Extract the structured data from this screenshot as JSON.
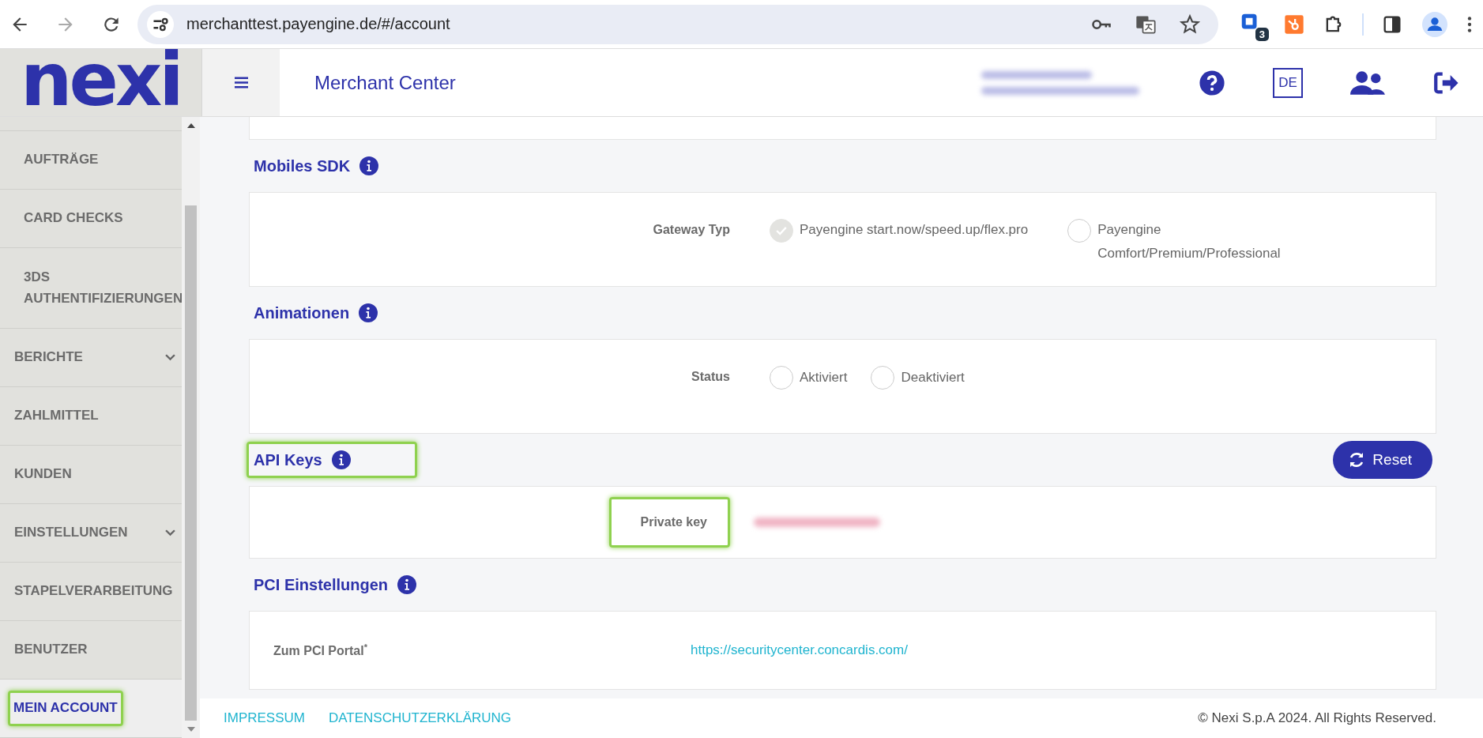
{
  "browser": {
    "url": "merchanttest.payengine.de/#/account",
    "extension_badge": "3"
  },
  "header": {
    "logo": "nexi",
    "title": "Merchant Center",
    "language": "DE"
  },
  "sidebar": {
    "items": [
      {
        "label": "AUFTRÄGE",
        "kind": "subitem",
        "expandable": false,
        "selected": false,
        "highlighted": false
      },
      {
        "label": "CARD CHECKS",
        "kind": "subitem",
        "expandable": false,
        "selected": false,
        "highlighted": false
      },
      {
        "label": "3DS AUTHENTIFIZIERUNGEN",
        "kind": "subitem",
        "expandable": false,
        "selected": false,
        "highlighted": false
      },
      {
        "label": "BERICHTE",
        "kind": "item",
        "expandable": true,
        "selected": false,
        "highlighted": false
      },
      {
        "label": "ZAHLMITTEL",
        "kind": "item",
        "expandable": false,
        "selected": false,
        "highlighted": false
      },
      {
        "label": "KUNDEN",
        "kind": "item",
        "expandable": false,
        "selected": false,
        "highlighted": false
      },
      {
        "label": "EINSTELLUNGEN",
        "kind": "item",
        "expandable": true,
        "selected": false,
        "highlighted": false
      },
      {
        "label": "STAPELVERARBEITUNG",
        "kind": "item",
        "expandable": false,
        "selected": false,
        "highlighted": false
      },
      {
        "label": "BENUTZER",
        "kind": "item",
        "expandable": false,
        "selected": false,
        "highlighted": false
      },
      {
        "label": "MEIN ACCOUNT",
        "kind": "item",
        "expandable": false,
        "selected": true,
        "highlighted": true
      }
    ]
  },
  "sections": [
    {
      "title": "Mobiles SDK",
      "kind": "radio",
      "highlighted": false,
      "field": {
        "label": "Gateway Typ",
        "options": [
          {
            "label": "Payengine start.now/speed.up/flex.pro",
            "selected": true
          },
          {
            "label": "Payengine Comfort/Premium/Professional",
            "selected": false
          }
        ]
      }
    },
    {
      "title": "Animationen",
      "kind": "radio",
      "highlighted": false,
      "field": {
        "label": "Status",
        "options": [
          {
            "label": "Aktiviert",
            "selected": false
          },
          {
            "label": "Deaktiviert",
            "selected": false
          }
        ]
      }
    },
    {
      "title": "API Keys",
      "kind": "key",
      "highlighted": true,
      "button": "Reset",
      "field": {
        "label": "Private key",
        "highlighted": true
      }
    },
    {
      "title": "PCI Einstellungen",
      "kind": "link",
      "highlighted": false,
      "field": {
        "label": "Zum PCI Portal",
        "required_mark": "*",
        "value": "https://securitycenter.concardis.com/"
      }
    }
  ],
  "footer": {
    "links": [
      "IMPRESSUM",
      "DATENSCHUTZERKLÄRUNG"
    ],
    "copyright": "© Nexi S.p.A 2024. All Rights Reserved."
  }
}
